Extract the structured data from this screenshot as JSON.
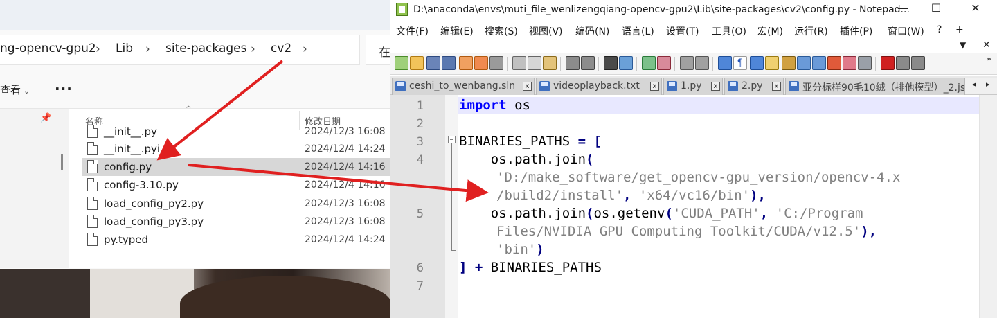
{
  "explorer": {
    "breadcrumb": [
      "ng-opencv-gpu2",
      "Lib",
      "site-packages",
      "cv2"
    ],
    "chevron": "›",
    "search_stub": "在",
    "view_label": "查看",
    "more_label": "···",
    "columns": {
      "name": "名称",
      "modified": "修改日期"
    },
    "files": [
      {
        "name": "__init__.py",
        "date": "2024/12/3 16:08"
      },
      {
        "name": "__init__.pyi",
        "date": "2024/12/4 14:24"
      },
      {
        "name": "config.py",
        "date": "2024/12/4 14:16",
        "selected": true
      },
      {
        "name": "config-3.10.py",
        "date": "2024/12/4 14:16"
      },
      {
        "name": "load_config_py2.py",
        "date": "2024/12/3 16:08"
      },
      {
        "name": "load_config_py3.py",
        "date": "2024/12/3 16:08"
      },
      {
        "name": "py.typed",
        "date": "2024/12/4 14:24"
      }
    ]
  },
  "notepad": {
    "title": "D:\\anaconda\\envs\\muti_file_wenlizengqiang-opencv-gpu2\\Lib\\site-packages\\cv2\\config.py - Notepad...",
    "window_buttons": {
      "minimize": "—",
      "maximize": "☐",
      "close": "✕"
    },
    "menu": [
      "文件(F)",
      "编辑(E)",
      "搜索(S)",
      "视图(V)",
      "编码(N)",
      "语言(L)",
      "设置(T)",
      "工具(O)",
      "宏(M)",
      "运行(R)",
      "插件(P)",
      "窗口(W)",
      "?",
      "+"
    ],
    "sub_controls": {
      "dropdown": "▼",
      "close": "✕"
    },
    "tabs": [
      {
        "label": "ceshi_to_wenbang.sln"
      },
      {
        "label": "videoplayback.txt"
      },
      {
        "label": "1.py"
      },
      {
        "label": "2.py"
      },
      {
        "label": "亚分标样90毛10绒（排他模型）_2.js"
      }
    ],
    "tab_close": "x",
    "tab_scroll": {
      "left": "◂",
      "right": "▸"
    },
    "toolbar_more": "»",
    "line_numbers": [
      "1",
      "2",
      "3",
      "4",
      "5",
      "6",
      "7"
    ],
    "code": {
      "l1_kw": "import",
      "l1_rest": " os",
      "l3_name": "BINARIES_PATHS ",
      "l3_eq": "= [",
      "l4a": "    os.path.join",
      "l4b": "(",
      "l4c_str": "'D:/make_software/get_opencv-gpu_version/opencv-4.x",
      "l4d_str": "/build2/install'",
      "l4d_sep": ", ",
      "l4d_str2": "'x64/vc16/bin'",
      "l4d_end": "),",
      "l5a": "    os.path.join",
      "l5b": "(",
      "l5c": "os.getenv",
      "l5d": "(",
      "l5e_str": "'CUDA_PATH'",
      "l5f": ", ",
      "l5g_str": "'C:/Program",
      "l5h_str": "Files/NVIDIA GPU Computing Toolkit/CUDA/v12.5'",
      "l5h_end": "),",
      "l5i_str": "'bin'",
      "l5i_end": ")",
      "l6a": "]",
      "l6b": " + ",
      "l6c": "BINARIES_PATHS"
    }
  },
  "colors": {
    "arrow": "#e02020",
    "keyword": "#0000ff",
    "string": "#808080",
    "operator": "#000080"
  }
}
